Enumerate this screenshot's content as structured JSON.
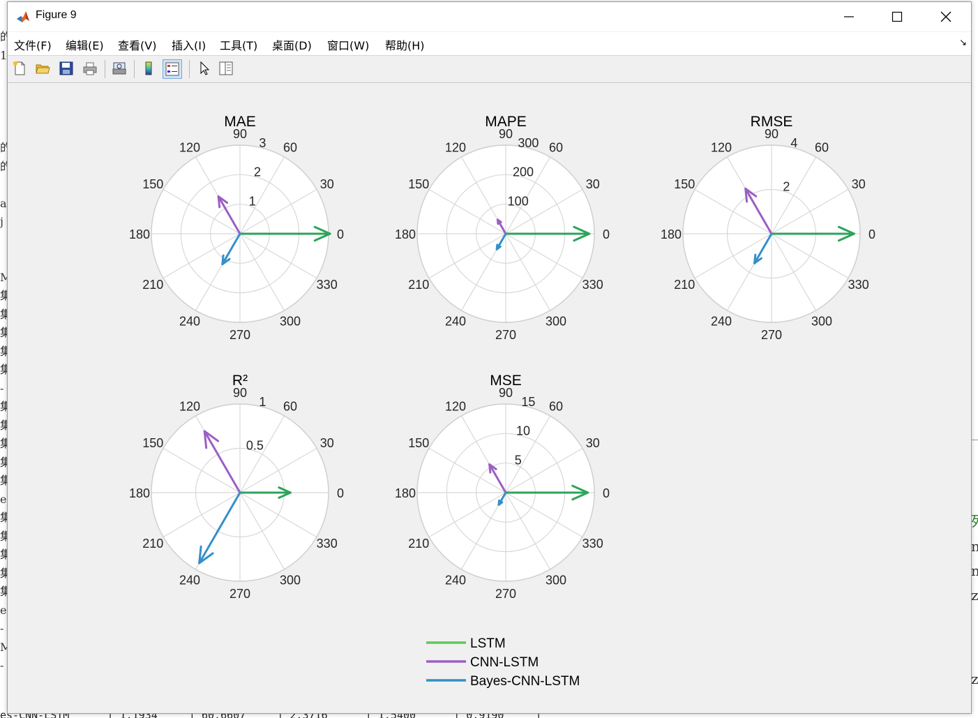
{
  "window": {
    "title": "Figure 9",
    "controls": {
      "minimize": "minimize",
      "maximize": "maximize",
      "close": "close"
    }
  },
  "menu": [
    "文件(F)",
    "编辑(E)",
    "查看(V)",
    "插入(I)",
    "工具(T)",
    "桌面(D)",
    "窗口(W)",
    "帮助(H)"
  ],
  "toolbar": [
    "new-figure",
    "open-file",
    "save",
    "print",
    "print-preview",
    "colorbar",
    "legend",
    "pointer",
    "property-editor"
  ],
  "colors": {
    "LSTM": "#2ca45a",
    "CNN-LSTM": "#9a5fc4",
    "Bayes-CNN-LSTM": "#3490c8",
    "grid": "#d8d8d8"
  },
  "legend": {
    "entries": [
      {
        "label": "LSTM",
        "color": "#5bc95b"
      },
      {
        "label": "CNN-LSTM",
        "color": "#9a5fc4"
      },
      {
        "label": "Bayes-CNN-LSTM",
        "color": "#3490c8"
      }
    ]
  },
  "chart_data": [
    {
      "type": "polar-compass",
      "title": "MAE",
      "rmax": 3,
      "rticks": [
        1,
        2,
        3
      ],
      "theta_ticks": [
        0,
        30,
        60,
        90,
        120,
        150,
        180,
        210,
        240,
        270,
        300,
        330
      ],
      "series": [
        {
          "name": "LSTM",
          "angle": 0,
          "value": 3.05
        },
        {
          "name": "CNN-LSTM",
          "angle": 120,
          "value": 1.46
        },
        {
          "name": "Bayes-CNN-LSTM",
          "angle": 240,
          "value": 1.19
        }
      ]
    },
    {
      "type": "polar-compass",
      "title": "MAPE",
      "rmax": 300,
      "rticks": [
        100,
        200,
        300
      ],
      "theta_ticks": [
        0,
        30,
        60,
        90,
        120,
        150,
        180,
        210,
        240,
        270,
        300,
        330
      ],
      "series": [
        {
          "name": "LSTM",
          "angle": 0,
          "value": 283
        },
        {
          "name": "CNN-LSTM",
          "angle": 120,
          "value": 55
        },
        {
          "name": "Bayes-CNN-LSTM",
          "angle": 240,
          "value": 60.66
        }
      ]
    },
    {
      "type": "polar-compass",
      "title": "RMSE",
      "rmax": 4,
      "rticks": [
        2,
        4
      ],
      "theta_ticks": [
        0,
        30,
        60,
        90,
        120,
        150,
        180,
        210,
        240,
        270,
        300,
        330
      ],
      "series": [
        {
          "name": "LSTM",
          "angle": 0,
          "value": 3.73
        },
        {
          "name": "CNN-LSTM",
          "angle": 120,
          "value": 2.35
        },
        {
          "name": "Bayes-CNN-LSTM",
          "angle": 240,
          "value": 1.54
        }
      ]
    },
    {
      "type": "polar-compass",
      "title": "R²",
      "rmax": 1,
      "rticks": [
        0.5,
        1
      ],
      "theta_ticks": [
        0,
        30,
        60,
        90,
        120,
        150,
        180,
        210,
        240,
        270,
        300,
        330
      ],
      "series": [
        {
          "name": "LSTM",
          "angle": 0,
          "value": 0.57
        },
        {
          "name": "CNN-LSTM",
          "angle": 120,
          "value": 0.8
        },
        {
          "name": "Bayes-CNN-LSTM",
          "angle": 240,
          "value": 0.919
        }
      ]
    },
    {
      "type": "polar-compass",
      "title": "MSE",
      "rmax": 15,
      "rticks": [
        5,
        10,
        15
      ],
      "theta_ticks": [
        0,
        30,
        60,
        90,
        120,
        150,
        180,
        210,
        240,
        270,
        300,
        330
      ],
      "series": [
        {
          "name": "LSTM",
          "angle": 0,
          "value": 13.9
        },
        {
          "name": "CNN-LSTM",
          "angle": 120,
          "value": 5.52
        },
        {
          "name": "Bayes-CNN-LSTM",
          "angle": 240,
          "value": 2.37
        }
      ]
    }
  ],
  "background": {
    "left_glyphs": [
      "的",
      "1",
      "",
      "",
      "",
      "",
      "的",
      "的",
      "",
      "a",
      "j",
      "",
      "",
      "M",
      "集",
      "集",
      "集",
      "集",
      "集",
      "-",
      "集",
      "集",
      "集",
      "集",
      "集",
      "e",
      "集",
      "集",
      "集",
      "集",
      "集",
      "e",
      "-",
      "M",
      "-"
    ],
    "bottom_row": "es-CNN-LSTM      | 1.1934     | 60.6607     | 2.3716      | 1.5400      | 0.9190     |",
    "right_glyphs": [
      "列",
      "n",
      "n",
      "z",
      "z"
    ]
  }
}
